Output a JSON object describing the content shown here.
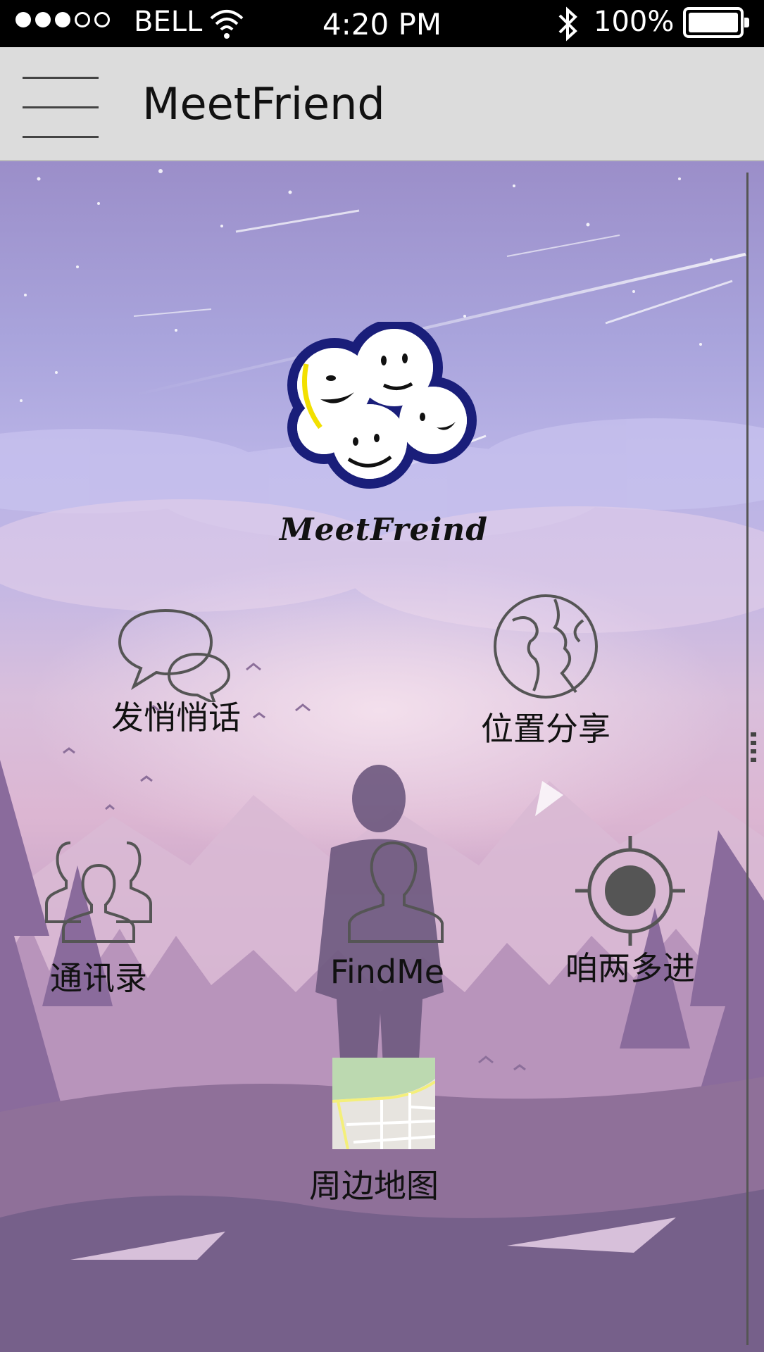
{
  "status_bar": {
    "signal_dots": "●●●○○",
    "carrier": "BELL",
    "time": "4:20 PM",
    "battery": "100%",
    "icons": [
      "wifi-icon",
      "bluetooth-icon",
      "battery-icon"
    ]
  },
  "app_bar": {
    "menu_icon": "hamburger-menu-icon",
    "title": "MeetFriend"
  },
  "logo": {
    "text": "MeetFreind",
    "icon": "smiley-cloud-logo"
  },
  "features": [
    {
      "label": "发悄悄话",
      "icon": "chat-bubbles-icon"
    },
    {
      "label": "位置分享",
      "icon": "globe-icon"
    },
    {
      "label": "通讯录",
      "icon": "contacts-group-icon"
    },
    {
      "label": "FindMe",
      "icon": "person-icon"
    },
    {
      "label": "咱两多进",
      "icon": "target-icon"
    },
    {
      "label": "周边地图",
      "icon": "map-icon"
    }
  ],
  "colors": {
    "status_bar": "#000000",
    "app_bar": "#dcdcdc",
    "sky_top": "#9b8ec9",
    "sky_bottom": "#7f6794"
  }
}
